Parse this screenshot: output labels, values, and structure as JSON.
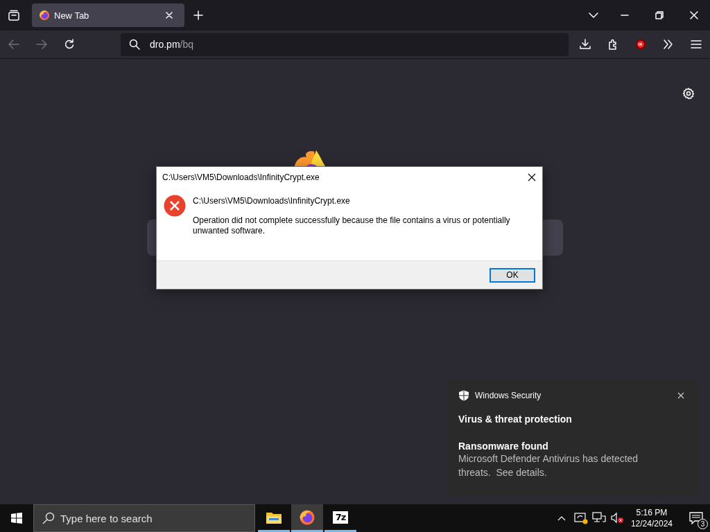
{
  "browser": {
    "tabs": [
      {
        "title": "New Tab",
        "selected": true
      }
    ],
    "url": {
      "host": "dro.pm",
      "path": "/bq"
    }
  },
  "dialog": {
    "title": "C:\\Users\\VM5\\Downloads\\InfinityCrypt.exe",
    "heading": "C:\\Users\\VM5\\Downloads\\InfinityCrypt.exe",
    "message": "Operation did not complete successfully because the file contains a virus or potentially unwanted software.",
    "buttons": [
      {
        "label": "OK",
        "selected": true
      }
    ]
  },
  "toast": {
    "app": "Windows Security",
    "title": "Virus & threat protection",
    "heading": "Ransomware found",
    "body": "Microsoft Defender Antivirus has detected threats.  See details."
  },
  "taskbar": {
    "search_placeholder": "Type here to search",
    "apps": [
      {
        "kind": "folder",
        "selected": false
      },
      {
        "kind": "firefox",
        "selected": true
      },
      {
        "kind": "archiver",
        "label": "7z",
        "selected": false
      }
    ],
    "time": "5:16 PM",
    "date": "12/24/2024",
    "notification_count": "3"
  }
}
